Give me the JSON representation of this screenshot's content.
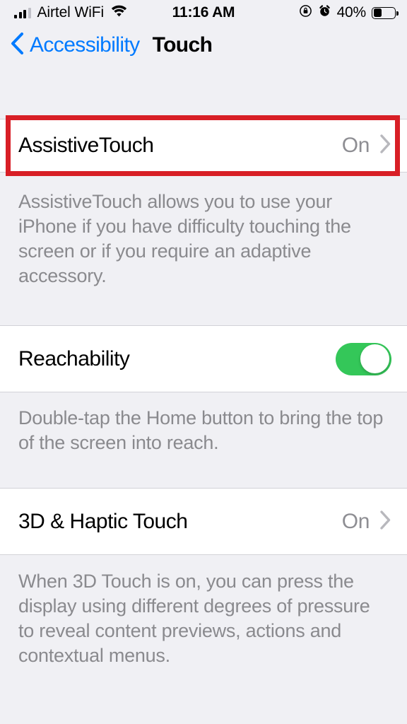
{
  "status_bar": {
    "carrier": "Airtel WiFi",
    "signal_bars_filled": 3,
    "signal_bars_total": 4,
    "wifi_icon": "wifi-icon",
    "time": "11:16 AM",
    "rotation_lock_icon": "rotation-lock-icon",
    "alarm_icon": "alarm-clock-icon",
    "battery_percent": "40%",
    "battery_level": 40
  },
  "nav": {
    "back_label": "Accessibility",
    "back_icon": "chevron-left-icon",
    "title": "Touch"
  },
  "sections": {
    "assistivetouch": {
      "title": "AssistiveTouch",
      "value": "On",
      "disclosure_icon": "chevron-right-icon",
      "footer": "AssistiveTouch allows you to use your iPhone if you have difficulty touching the screen or if you require an adaptive accessory."
    },
    "reachability": {
      "title": "Reachability",
      "toggle_on": true,
      "footer": "Double-tap the Home button to bring the top of the screen into reach."
    },
    "haptic": {
      "title": "3D & Haptic Touch",
      "value": "On",
      "disclosure_icon": "chevron-right-icon",
      "footer": "When 3D Touch is on, you can press the display using different degrees of pressure to reveal content previews, actions and contextual menus."
    }
  },
  "annotation": {
    "color": "#d81f26",
    "target": "assistivetouch-row"
  },
  "colors": {
    "background": "#f0f0f4",
    "cell_background": "#ffffff",
    "accent_blue": "#007aff",
    "toggle_green": "#34c759",
    "secondary_text": "#8e8e93",
    "annotation_red": "#d81f26"
  }
}
